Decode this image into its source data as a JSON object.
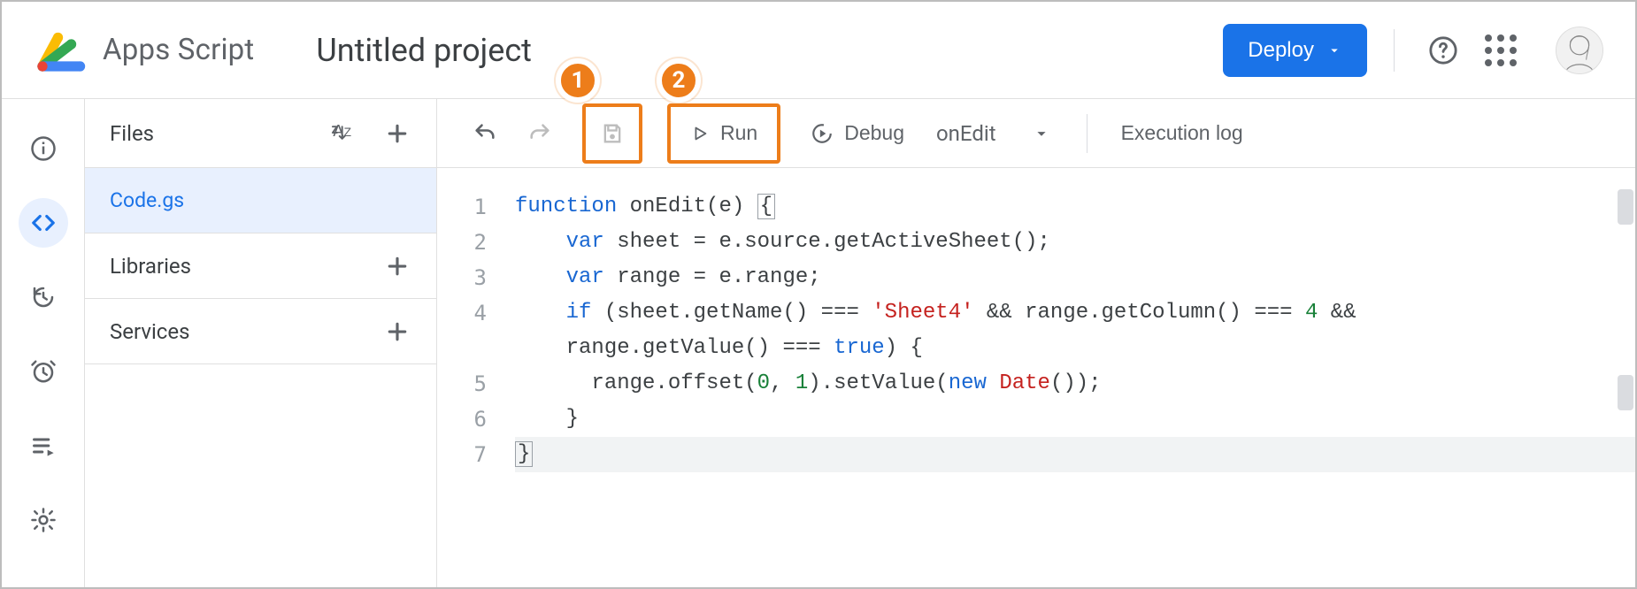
{
  "header": {
    "product": "Apps Script",
    "project_title": "Untitled project",
    "deploy_label": "Deploy"
  },
  "rail": {
    "items": [
      "overview",
      "editor",
      "triggers",
      "executions",
      "logs",
      "settings"
    ],
    "active_index": 1
  },
  "files_panel": {
    "header": "Files",
    "files": [
      {
        "name": "Code.gs",
        "selected": true
      }
    ],
    "libraries_label": "Libraries",
    "services_label": "Services"
  },
  "toolbar": {
    "run_label": "Run",
    "debug_label": "Debug",
    "function_selected": "onEdit",
    "execution_log_label": "Execution log"
  },
  "callouts": {
    "save": "1",
    "run": "2"
  },
  "code": {
    "lines": [
      "function onEdit(e) {",
      "    var sheet = e.source.getActiveSheet();",
      "    var range = e.range;",
      "    if (sheet.getName() === 'Sheet4' && range.getColumn() === 4 && ",
      "range.getValue() === true) {",
      "      range.offset(0, 1).setValue(new Date());",
      "    }",
      "}"
    ],
    "line_numbers": [
      "1",
      "2",
      "3",
      "4",
      "5",
      "6",
      "7"
    ],
    "string_literal": "'Sheet4'",
    "number_4": "4",
    "number_0": "0",
    "number_1": "1"
  }
}
